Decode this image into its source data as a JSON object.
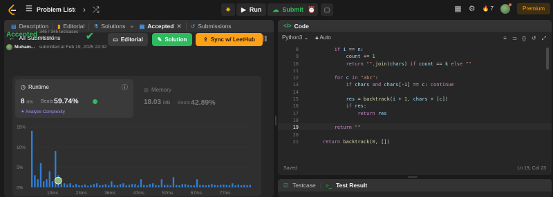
{
  "topbar": {
    "problem_list_label": "Problem List",
    "run_label": "Run",
    "submit_label": "Submit",
    "streak_count": "7",
    "premium_label": "Premium"
  },
  "left": {
    "tabs": [
      {
        "label": "Description"
      },
      {
        "label": "Editorial"
      },
      {
        "label": "Solutions"
      },
      {
        "label": "Accepted"
      },
      {
        "label": "Submissions"
      }
    ],
    "back_label": "All Submissions",
    "status": "Accepted",
    "testcases": "345 / 345 testcases passed",
    "author": "Muham...",
    "submitted_at": "submitted at Feb 19, 2025 22:32",
    "buttons": {
      "editorial": "Editorial",
      "solution": "Solution",
      "sync": "Sync w/ LeetHub"
    },
    "runtime": {
      "title": "Runtime",
      "value": "8",
      "unit": "ms",
      "beats_label": "Beats",
      "beats_pct": "59.74%",
      "analyze": "Analyze Complexity"
    },
    "memory": {
      "title": "Memory",
      "value": "18.03",
      "unit": "MB",
      "beats_label": "Beats",
      "beats_pct": "42.89%"
    }
  },
  "code": {
    "header": "Code",
    "language": "Python3",
    "format": "Auto",
    "saved": "Saved",
    "cursor": "Ln 19, Col 23",
    "line_numbers": [
      "8",
      "9",
      "10",
      "11",
      "12",
      "13",
      "14",
      "15",
      "16",
      "17",
      "18",
      "19",
      "20",
      "21"
    ],
    "current_line": "19",
    "lines": [
      "        if i == n:",
      "            count += 1",
      "            return \"\".join(chars) if count == k else \"\"",
      "",
      "        for c in \"abc\":",
      "            if chars and chars[-1] == c: continue",
      "",
      "            res = backtrack(i + 1, chars + [c])",
      "            if res:",
      "                return res",
      "",
      "        return \"\"",
      "",
      "    return backtrack(0, [])"
    ]
  },
  "test": {
    "testcase_label": "Testcase",
    "result_label": "Test Result"
  },
  "chart_data": {
    "type": "bar",
    "x_tick_labels": [
      "10ms",
      "23ms",
      "36ms",
      "47ms",
      "57ms",
      "67ms",
      "77ms"
    ],
    "y_tick_labels": [
      "15%",
      "10%",
      "5%",
      "0%"
    ],
    "ylim": [
      0,
      15
    ],
    "values": [
      14,
      3,
      2,
      6,
      1.5,
      2,
      4,
      1.5,
      9,
      3,
      1,
      1,
      0.7,
      1,
      0.5,
      0.8,
      0.5,
      0.5,
      0.7,
      0.4,
      0.6,
      0.8,
      1,
      0.5,
      0.6,
      0.8,
      0.5,
      1.5,
      0.6,
      0.5,
      0.8,
      1,
      0.5,
      0.6,
      0.8,
      0.8,
      0.5,
      2,
      0.6,
      0.5,
      0.8,
      1,
      0.6,
      0.5,
      2,
      0.6,
      0.6,
      0.5,
      2.5,
      0.6,
      0.5,
      0.8,
      0.8,
      0.6,
      0.5,
      0.5,
      2,
      0.6,
      0.6,
      0.5,
      0.6,
      0.8,
      0.6,
      0.5,
      0.6,
      0.7,
      0.6,
      0.5,
      1,
      0.5,
      0.7,
      0.5,
      0.6,
      0.5,
      0.6
    ],
    "highlight_index": 8,
    "bar_color": "#2f7fd6"
  }
}
